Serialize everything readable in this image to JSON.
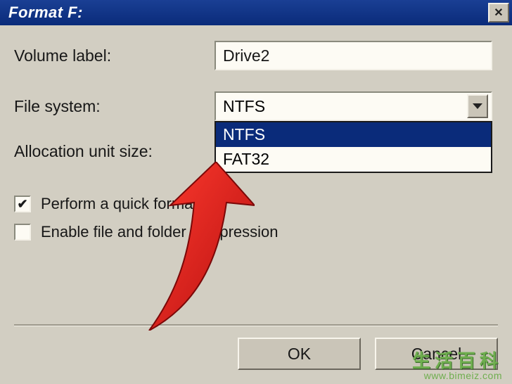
{
  "title": "Format F:",
  "labels": {
    "volume_label": "Volume label:",
    "file_system": "File system:",
    "allocation_unit_size": "Allocation unit size:"
  },
  "fields": {
    "volume_label_value": "Drive2",
    "file_system_selected": "NTFS",
    "file_system_options": [
      "NTFS",
      "FAT32"
    ]
  },
  "checkboxes": {
    "quick_format": {
      "label": "Perform a quick format",
      "checked": true
    },
    "compression": {
      "label": "Enable file and folder compression",
      "checked": false
    }
  },
  "buttons": {
    "ok": "OK",
    "cancel": "Cancel"
  },
  "watermark": {
    "line1": "生活百科",
    "line2": "www.bimeiz.com"
  }
}
